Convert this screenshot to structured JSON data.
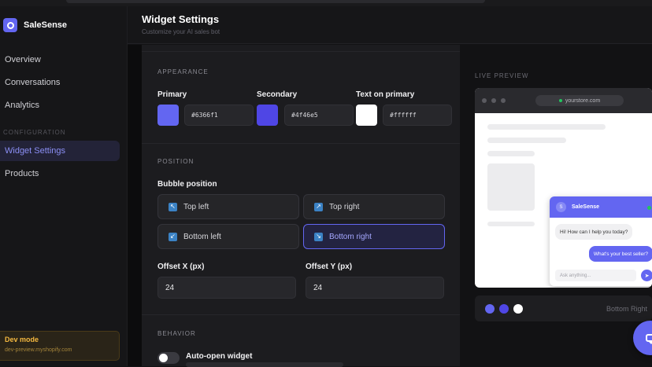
{
  "app": {
    "name": "SaleSense",
    "logo_icon": "chat-logo-icon"
  },
  "sidebar": {
    "items": [
      {
        "label": "Overview"
      },
      {
        "label": "Conversations"
      },
      {
        "label": "Analytics"
      }
    ],
    "section": "CONFIGURATION",
    "config_items": [
      {
        "label": "Widget Settings",
        "active": true
      },
      {
        "label": "Products"
      }
    ],
    "dev": {
      "title": "Dev mode",
      "store": "dev-preview.myshopify.com"
    }
  },
  "header": {
    "title": "Widget Settings",
    "subtitle": "Customize your AI sales bot"
  },
  "appearance": {
    "label": "APPEARANCE",
    "primary": {
      "label": "Primary",
      "value": "#6366f1",
      "color": "#6366f1"
    },
    "secondary": {
      "label": "Secondary",
      "value": "#4f46e5",
      "color": "#4f46e5"
    },
    "text_on_primary": {
      "label": "Text on primary",
      "value": "#ffffff",
      "color": "#ffffff"
    }
  },
  "position": {
    "label": "POSITION",
    "bubble_label": "Bubble position",
    "options": [
      "Top left",
      "Top right",
      "Bottom left",
      "Bottom right"
    ],
    "selected": "Bottom right",
    "offset_x": {
      "label": "Offset X (px)",
      "value": "24"
    },
    "offset_y": {
      "label": "Offset Y (px)",
      "value": "24"
    }
  },
  "behavior": {
    "label": "BEHAVIOR",
    "auto_open": {
      "label": "Auto-open widget",
      "enabled": false
    }
  },
  "preview": {
    "label": "LIVE PREVIEW",
    "url": "yourstore.com",
    "chat": {
      "avatar": "S",
      "name": "SaleSense",
      "bot_msg": "Hi! How can I help you today?",
      "user_msg": "What's your best seller?",
      "input_placeholder": "Ask anything...",
      "send_icon": "➤"
    },
    "footer": {
      "colors": [
        "#6366f1",
        "#4f46e5",
        "#ffffff"
      ],
      "position_text": "Bottom Right"
    }
  }
}
